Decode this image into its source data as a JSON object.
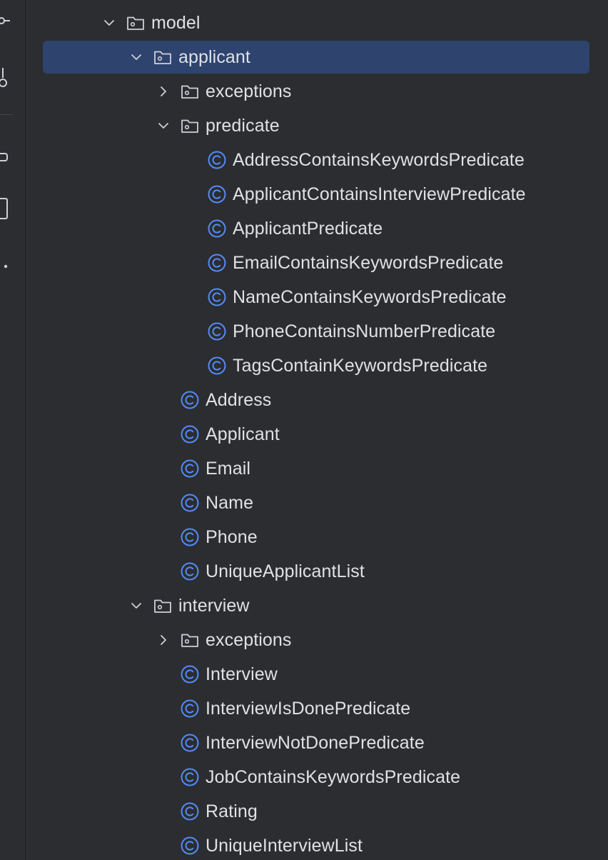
{
  "tree": {
    "items": [
      {
        "label": "model",
        "kind": "folder",
        "depth": 0,
        "state": "expanded"
      },
      {
        "label": "applicant",
        "kind": "folder",
        "depth": 1,
        "state": "expanded",
        "selected": true
      },
      {
        "label": "exceptions",
        "kind": "folder",
        "depth": 2,
        "state": "collapsed"
      },
      {
        "label": "predicate",
        "kind": "folder",
        "depth": 2,
        "state": "expanded"
      },
      {
        "label": "AddressContainsKeywordsPredicate",
        "kind": "class",
        "depth": 3
      },
      {
        "label": "ApplicantContainsInterviewPredicate",
        "kind": "class",
        "depth": 3
      },
      {
        "label": "ApplicantPredicate",
        "kind": "class",
        "depth": 3
      },
      {
        "label": "EmailContainsKeywordsPredicate",
        "kind": "class",
        "depth": 3
      },
      {
        "label": "NameContainsKeywordsPredicate",
        "kind": "class",
        "depth": 3
      },
      {
        "label": "PhoneContainsNumberPredicate",
        "kind": "class",
        "depth": 3
      },
      {
        "label": "TagsContainKeywordsPredicate",
        "kind": "class",
        "depth": 3
      },
      {
        "label": "Address",
        "kind": "class",
        "depth": 2
      },
      {
        "label": "Applicant",
        "kind": "class",
        "depth": 2
      },
      {
        "label": "Email",
        "kind": "class",
        "depth": 2
      },
      {
        "label": "Name",
        "kind": "class",
        "depth": 2
      },
      {
        "label": "Phone",
        "kind": "class",
        "depth": 2
      },
      {
        "label": "UniqueApplicantList",
        "kind": "class",
        "depth": 2
      },
      {
        "label": "interview",
        "kind": "folder",
        "depth": 1,
        "state": "expanded"
      },
      {
        "label": "exceptions",
        "kind": "folder",
        "depth": 2,
        "state": "collapsed"
      },
      {
        "label": "Interview",
        "kind": "class",
        "depth": 2
      },
      {
        "label": "InterviewIsDonePredicate",
        "kind": "class",
        "depth": 2
      },
      {
        "label": "InterviewNotDonePredicate",
        "kind": "class",
        "depth": 2
      },
      {
        "label": "JobContainsKeywordsPredicate",
        "kind": "class",
        "depth": 2
      },
      {
        "label": "Rating",
        "kind": "class",
        "depth": 2
      },
      {
        "label": "UniqueInterviewList",
        "kind": "class",
        "depth": 2
      }
    ]
  },
  "left_strip": {
    "icons": [
      "commit-icon",
      "pull-requests-icon",
      "structure-icon",
      "bookmarks-icon",
      "more-icon"
    ]
  },
  "colors": {
    "background": "#2b2d30",
    "selection": "#2e436e",
    "text": "#dfe1e5",
    "icon_gray": "#ced0d6",
    "class_blue": "#548af7"
  }
}
